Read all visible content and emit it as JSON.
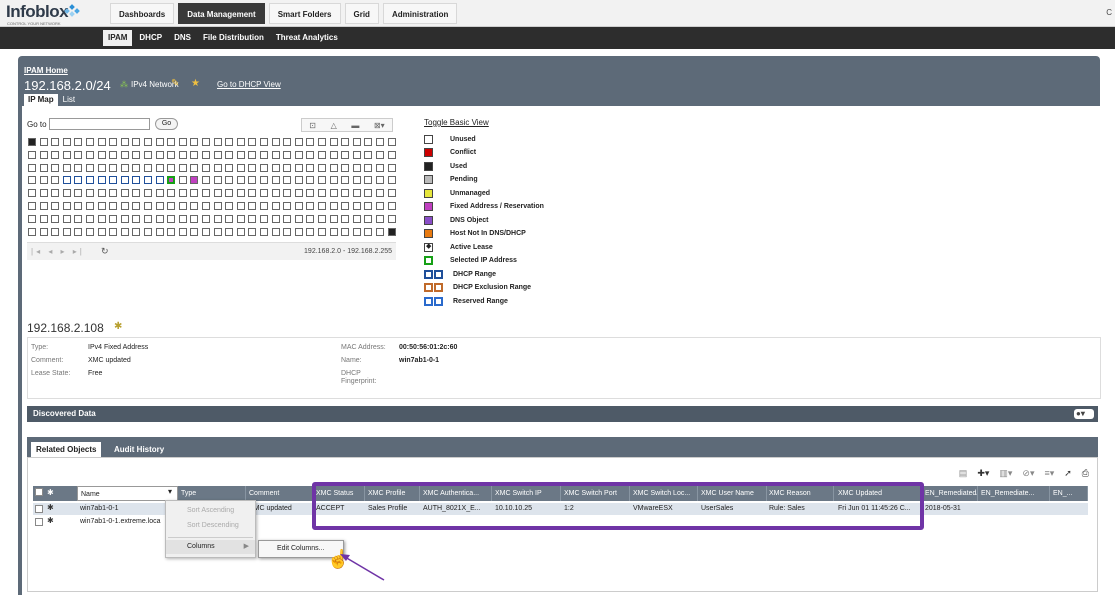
{
  "app": {
    "logo": "Infoblox",
    "logo_tagline": "CONTROL YOUR NETWORK",
    "main_tabs": [
      {
        "label": "Dashboards",
        "active": false
      },
      {
        "label": "Data Management",
        "active": true
      },
      {
        "label": "Smart Folders",
        "active": false
      },
      {
        "label": "Grid",
        "active": false
      },
      {
        "label": "Administration",
        "active": false
      }
    ],
    "top_right": "C",
    "sub_tabs": [
      {
        "label": "IPAM",
        "active": true
      },
      {
        "label": "DHCP",
        "active": false
      },
      {
        "label": "DNS",
        "active": false
      },
      {
        "label": "File Distribution",
        "active": false
      },
      {
        "label": "Threat Analytics",
        "active": false
      }
    ]
  },
  "header": {
    "breadcrumb": "IPAM Home",
    "network": "192.168.2.0/24",
    "network_type": "IPv4 Network",
    "dhcp_link": "Go to DHCP View",
    "view_tabs": [
      "IP Map",
      "List"
    ]
  },
  "ipmap": {
    "goto_label": "Go to",
    "goto_value": "",
    "go_button": "Go",
    "range": "192.168.2.0 - 192.168.2.255",
    "toolbar_icons": [
      "lock-icon",
      "warning-icon",
      "comment-icon",
      "close-dropdown-icon"
    ]
  },
  "legend": {
    "toggle_label": "Toggle Basic View",
    "items": [
      {
        "label": "Unused",
        "color": "#ffffff"
      },
      {
        "label": "Conflict",
        "color": "#cc0000"
      },
      {
        "label": "Used",
        "color": "#222222"
      },
      {
        "label": "Pending",
        "color": "#bbbbbb"
      },
      {
        "label": "Unmanaged",
        "color": "#e6e63c"
      },
      {
        "label": "Fixed Address / Reservation",
        "color": "#c040c0"
      },
      {
        "label": "DNS Object",
        "color": "#8a4ec8"
      },
      {
        "label": "Host Not In DNS/DHCP",
        "color": "#e87a10"
      },
      {
        "label": "Active Lease",
        "color": "#ffffff"
      },
      {
        "label": "Selected IP Address",
        "color": "#16a016"
      },
      {
        "label": "DHCP Range",
        "color": "#1f4f9a"
      },
      {
        "label": "DHCP Exclusion Range",
        "color": "#c06a2a"
      },
      {
        "label": "Reserved Range",
        "color": "#2a6acc"
      }
    ]
  },
  "detail": {
    "ip": "192.168.2.108",
    "type_label": "Type:",
    "type_value": "IPv4 Fixed Address",
    "comment_label": "Comment:",
    "comment_value": "XMC updated",
    "lease_label": "Lease State:",
    "lease_value": "Free",
    "mac_label": "MAC Address:",
    "mac_value": "00:50:56:01:2c:60",
    "name_label": "Name:",
    "name_value": "win7ab1-0-1",
    "fp_label1": "DHCP",
    "fp_label2": "Fingerprint:"
  },
  "discovered": {
    "title": "Discovered Data"
  },
  "related": {
    "tabs": [
      "Related Objects",
      "Audit History"
    ],
    "columns": [
      "Name",
      "Type",
      "Comment",
      "XMC Status",
      "XMC Profile",
      "XMC Authentica...",
      "XMC Switch IP",
      "XMC Switch Port",
      "XMC Switch Loc...",
      "XMC User Name",
      "XMC Reason",
      "XMC Updated",
      "EN_RemediatedAt",
      "EN_Remediate...",
      "EN_..."
    ],
    "rows": [
      {
        "name": "win7ab1-0-1",
        "type": "",
        "comment": "XMC updated",
        "xmc_status": "ACCEPT",
        "xmc_profile": "Sales Profile",
        "xmc_auth": "AUTH_8021X_E...",
        "xmc_switch_ip": "10.10.10.25",
        "xmc_switch_port": "1:2",
        "xmc_switch_loc": "VMwareESX",
        "xmc_user": "UserSales",
        "xmc_reason": "Rule: Sales",
        "xmc_updated": "Fri Jun 01 11:45:26 C...",
        "en_remediated_at": "2018-05-31"
      },
      {
        "name": "win7ab1-0-1.extreme.loca",
        "type": "",
        "comment": "",
        "xmc_status": "",
        "xmc_profile": "",
        "xmc_auth": "",
        "xmc_switch_ip": "",
        "xmc_switch_port": "",
        "xmc_switch_loc": "",
        "xmc_user": "",
        "xmc_reason": "",
        "xmc_updated": "",
        "en_remediated_at": ""
      }
    ],
    "menu": {
      "sort_asc": "Sort Ascending",
      "sort_desc": "Sort Descending",
      "columns": "Columns",
      "edit_columns": "Edit Columns..."
    }
  },
  "colors": {
    "highlight": "#6f34a6",
    "frame": "#5d6a78",
    "dark_bar": "#2d2d2d"
  }
}
